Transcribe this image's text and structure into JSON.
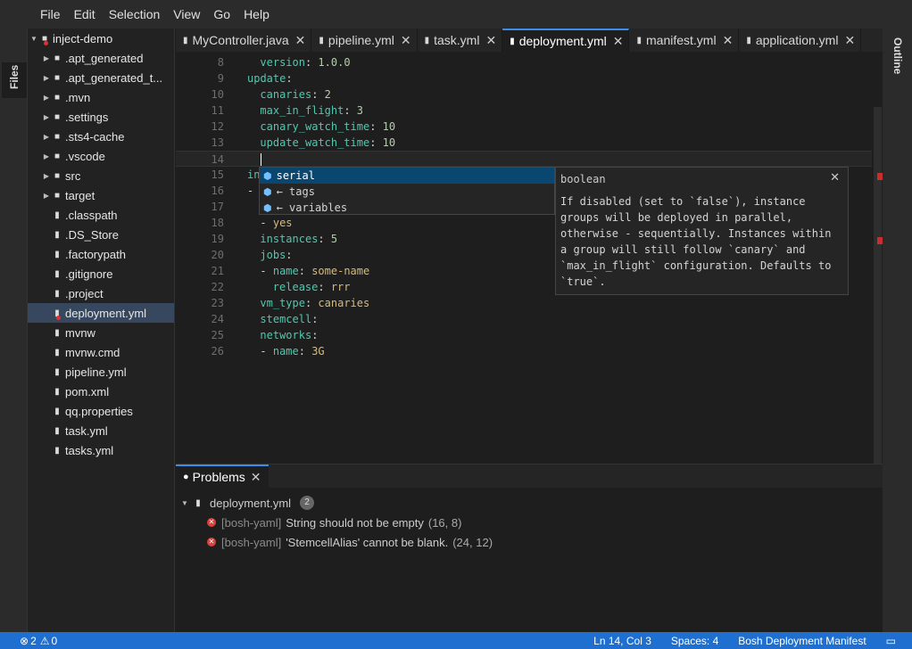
{
  "menu": [
    "File",
    "Edit",
    "Selection",
    "View",
    "Go",
    "Help"
  ],
  "left_panel_tab": "Files",
  "right_panel_tab": "Outline",
  "explorer": {
    "root": "inject-demo",
    "items": [
      {
        "label": ".apt_generated",
        "kind": "folder"
      },
      {
        "label": ".apt_generated_t...",
        "kind": "folder"
      },
      {
        "label": ".mvn",
        "kind": "folder"
      },
      {
        "label": ".settings",
        "kind": "folder"
      },
      {
        "label": ".sts4-cache",
        "kind": "folder"
      },
      {
        "label": ".vscode",
        "kind": "folder"
      },
      {
        "label": "src",
        "kind": "folder"
      },
      {
        "label": "target",
        "kind": "folder"
      },
      {
        "label": ".classpath",
        "kind": "file"
      },
      {
        "label": ".DS_Store",
        "kind": "file"
      },
      {
        "label": ".factorypath",
        "kind": "file"
      },
      {
        "label": ".gitignore",
        "kind": "file"
      },
      {
        "label": ".project",
        "kind": "file"
      },
      {
        "label": "deployment.yml",
        "kind": "file"
      },
      {
        "label": "mvnw",
        "kind": "file"
      },
      {
        "label": "mvnw.cmd",
        "kind": "file"
      },
      {
        "label": "pipeline.yml",
        "kind": "file"
      },
      {
        "label": "pom.xml",
        "kind": "file"
      },
      {
        "label": "qq.properties",
        "kind": "file"
      },
      {
        "label": "task.yml",
        "kind": "file"
      },
      {
        "label": "tasks.yml",
        "kind": "file"
      }
    ]
  },
  "tabs": [
    "MyController.java",
    "pipeline.yml",
    "task.yml",
    "deployment.yml",
    "manifest.yml",
    "application.yml"
  ],
  "editor": {
    "lines": [
      {
        "n": "8",
        "key": "version",
        "val": "1.0.0"
      },
      {
        "n": "9",
        "key": "update",
        "val": ""
      },
      {
        "n": "10",
        "key": "canaries",
        "val": "2"
      },
      {
        "n": "11",
        "key": "max_in_flight",
        "val": "3"
      },
      {
        "n": "12",
        "key": "canary_watch_time",
        "val": "10"
      },
      {
        "n": "13",
        "key": "update_watch_time",
        "val": "10"
      },
      {
        "n": "14",
        "key": "",
        "val": ""
      },
      {
        "n": "15",
        "key": "in",
        "val": ""
      },
      {
        "n": "16",
        "key": "-",
        "val": ""
      },
      {
        "n": "17",
        "key": "",
        "val": ""
      },
      {
        "n": "18",
        "key": "-",
        "val": "yes"
      },
      {
        "n": "19",
        "key": "instances",
        "val": "5"
      },
      {
        "n": "20",
        "key": "jobs",
        "val": ""
      },
      {
        "n": "21",
        "key": "- name",
        "val": "some-name"
      },
      {
        "n": "22",
        "key": "release",
        "val": "rrr"
      },
      {
        "n": "23",
        "key": "vm_type",
        "val": "canaries"
      },
      {
        "n": "24",
        "key": "stemcell",
        "val": ""
      },
      {
        "n": "25",
        "key": "networks",
        "val": ""
      },
      {
        "n": "26",
        "key": "- name",
        "val": "3G"
      }
    ]
  },
  "suggest": {
    "items": [
      "serial",
      "← tags",
      "← variables"
    ]
  },
  "detail": {
    "title": "boolean",
    "body": "If disabled (set to `false`), instance groups will be deployed in parallel, otherwise - sequentially. Instances within a group will still follow `canary` and `max_in_flight` configuration. Defaults to `true`."
  },
  "problems": {
    "tab_label": "Problems",
    "file": "deployment.yml",
    "count": "2",
    "items": [
      {
        "source": "[bosh-yaml]",
        "message": "String should not be empty",
        "pos": "(16, 8)"
      },
      {
        "source": "[bosh-yaml]",
        "message": "'StemcellAlias' cannot be blank.",
        "pos": "(24, 12)"
      }
    ]
  },
  "status": {
    "errors": "2",
    "warnings": "0",
    "position": "Ln 14, Col 3",
    "spaces": "Spaces: 4",
    "language": "Bosh Deployment Manifest"
  },
  "colors": {
    "accent": "#1f6fd0",
    "error": "#d9413d"
  }
}
